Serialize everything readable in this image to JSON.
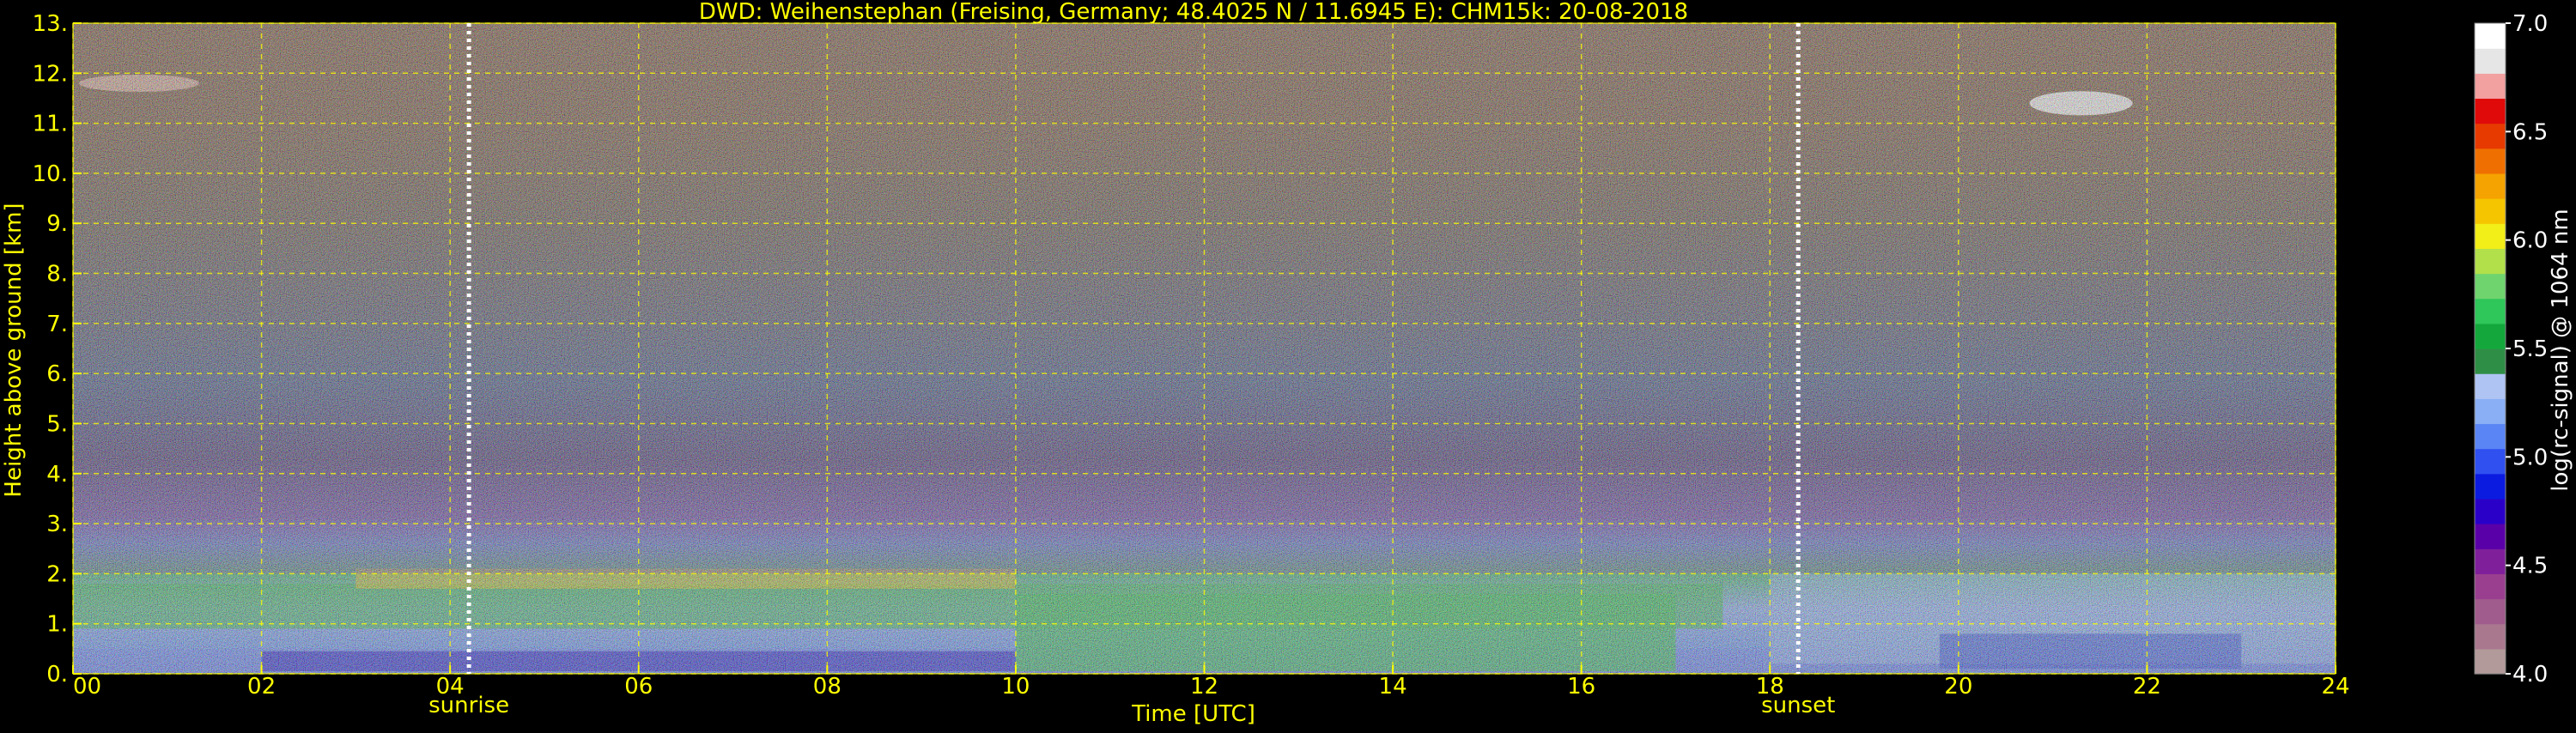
{
  "chart_data": {
    "type": "heatmap",
    "title": "DWD: Weihenstephan (Freising, Germany; 48.4025 N / 11.6945 E):    CHM15k: 20-08-2018",
    "xlabel": "Time [UTC]",
    "ylabel": "Height above ground [km]",
    "colorbar_label": "log(rc-signal) @ 1064 nm",
    "xlim": [
      0,
      24
    ],
    "ylim": [
      0,
      13
    ],
    "x_ticks": [
      0,
      2,
      4,
      6,
      8,
      10,
      12,
      14,
      16,
      18,
      20,
      22,
      24
    ],
    "x_tick_labels": [
      "00",
      "02",
      "04",
      "06",
      "08",
      "10",
      "12",
      "14",
      "16",
      "18",
      "20",
      "22",
      "24"
    ],
    "y_ticks": [
      0,
      1,
      2,
      3,
      4,
      5,
      6,
      7,
      8,
      9,
      10,
      11,
      12,
      13
    ],
    "y_tick_labels": [
      "0.",
      "1.",
      "2.",
      "3.",
      "4.",
      "5.",
      "6.",
      "7.",
      "8.",
      "9.",
      "10.",
      "11.",
      "12.",
      "13."
    ],
    "colorbar_range": [
      4.0,
      7.0
    ],
    "colorbar_ticks": [
      4.0,
      4.5,
      5.0,
      5.5,
      6.0,
      6.5,
      7.0
    ],
    "colorbar_tick_labels": [
      "4.0",
      "4.5",
      "5.0",
      "5.5",
      "6.0",
      "6.5",
      "7.0"
    ],
    "colormap": [
      "#b39a9a",
      "#a9788f",
      "#a05c8c",
      "#9a3f8f",
      "#7f1f9a",
      "#5a00a8",
      "#2a00c8",
      "#0b1be0",
      "#3050f0",
      "#5a85f5",
      "#8aaff5",
      "#b0c4f3",
      "#2f8e46",
      "#14a83c",
      "#2fc65a",
      "#6fd46e",
      "#b2e04a",
      "#f2ee18",
      "#f5c500",
      "#f5a300",
      "#ef7000",
      "#e63a00",
      "#e00a0a",
      "#f2a0a0",
      "#e6e6e6",
      "#ffffff"
    ],
    "events": [
      {
        "label": "sunrise",
        "x": 4.2
      },
      {
        "label": "sunset",
        "x": 18.3
      }
    ],
    "grid": true,
    "grid_color": "#ffff00",
    "text_color": "#ffff00"
  },
  "colors": {
    "background": "#000000",
    "axis_text": "#ffff00",
    "colorbar_text": "#ffffff",
    "event_line": "#ffffff"
  }
}
